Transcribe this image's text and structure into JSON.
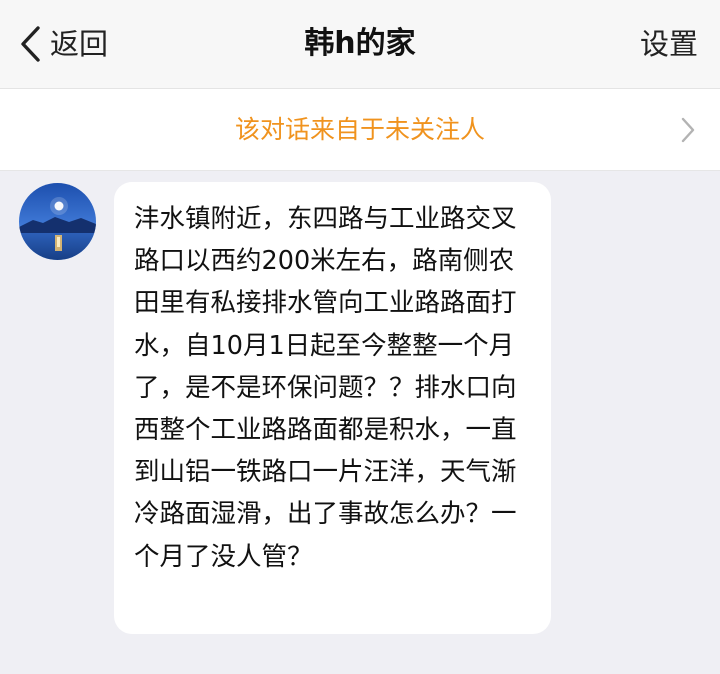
{
  "navbar": {
    "back_label": "返回",
    "title": "韩h的家",
    "settings_label": "设置"
  },
  "notice": {
    "text": "该对话来自于未关注人"
  },
  "message": {
    "text": "沣水镇附近，东四路与工业路交叉路口以西约200米左右，路南侧农田里有私接排水管向工业路路面打水，自10月1日起至今整整一个月了，是不是环保问题？？排水口向西整个工业路路面都是积水，一直到山铝一铁路口一片汪洋，天气渐冷路面湿滑，出了事故怎么办？一个月了没人管？"
  },
  "colors": {
    "notice_text": "#f0931e",
    "background": "#efeff4",
    "bubble": "#ffffff"
  },
  "icons": {
    "back": "chevron-left-icon",
    "notice_arrow": "chevron-right-icon",
    "avatar": "avatar-landscape-image"
  }
}
